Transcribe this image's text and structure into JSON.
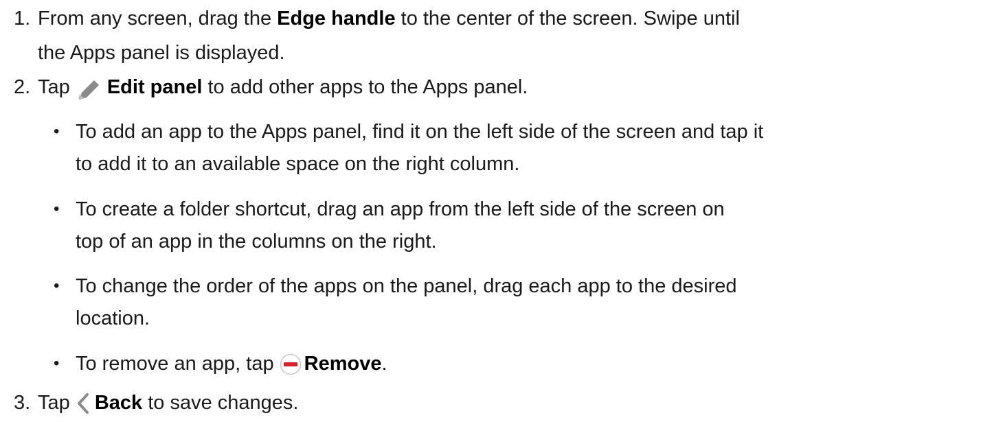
{
  "steps": [
    {
      "number": "1.",
      "pre": "From any screen, drag the ",
      "bold": "Edge handle",
      "post": " to the center of the screen. Swipe until",
      "cont": "the Apps panel is displayed."
    },
    {
      "number": "2.",
      "pre": "Tap ",
      "icon": "pencil-edit-icon",
      "bold": "Edit panel",
      "post": " to add other apps to the Apps panel.",
      "bullets": [
        {
          "line1": "To add an app to the Apps panel, find it on the left side of the screen and tap it",
          "line2": "to add it to an available space on the right column."
        },
        {
          "line1": "To create a folder shortcut, drag an app from the left side of the screen on",
          "line2": "top of an app in the columns on the right."
        },
        {
          "line1": "To change the order of the apps on the panel, drag each app to the desired",
          "line2": "location."
        },
        {
          "pre": "To remove an app, tap ",
          "icon": "remove-minus-icon",
          "bold": "Remove",
          "post": "."
        }
      ]
    },
    {
      "number": "3.",
      "pre": "Tap ",
      "icon": "chevron-left-back-icon",
      "bold": "Back",
      "post": " to save changes."
    }
  ],
  "bullet_glyph": "•",
  "colors": {
    "text": "#1a1a1a",
    "pencil_icon": "#8a8a8a",
    "remove_icon": "#d6202a",
    "back_icon": "#8a8a8a"
  }
}
